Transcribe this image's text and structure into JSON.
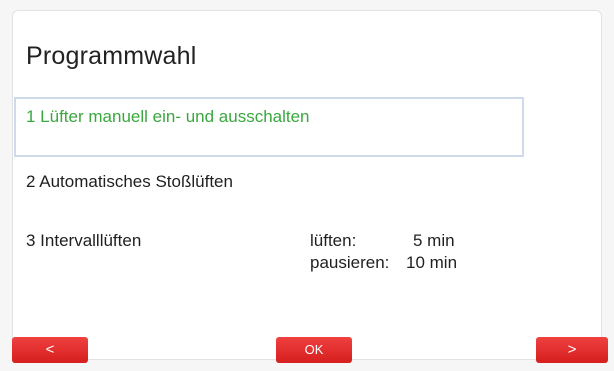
{
  "screen": {
    "title": "Programmwahl",
    "items": [
      {
        "label": "1 Lüfter manuell ein- und ausschalten",
        "selected": true
      },
      {
        "label": "2 Automatisches Stoßlüften",
        "selected": false
      },
      {
        "label": "3 Intervalllüften",
        "selected": false
      }
    ],
    "interval_params": [
      {
        "label": "lüften:",
        "value": "5 min"
      },
      {
        "label": "pausieren:",
        "value": "10 min"
      }
    ]
  },
  "buttons": {
    "back": "<",
    "ok": "OK",
    "next": ">"
  },
  "colors": {
    "selected_text": "#3aa73f",
    "selection_border": "#cfdbea",
    "button_red": "#e02a2a"
  }
}
